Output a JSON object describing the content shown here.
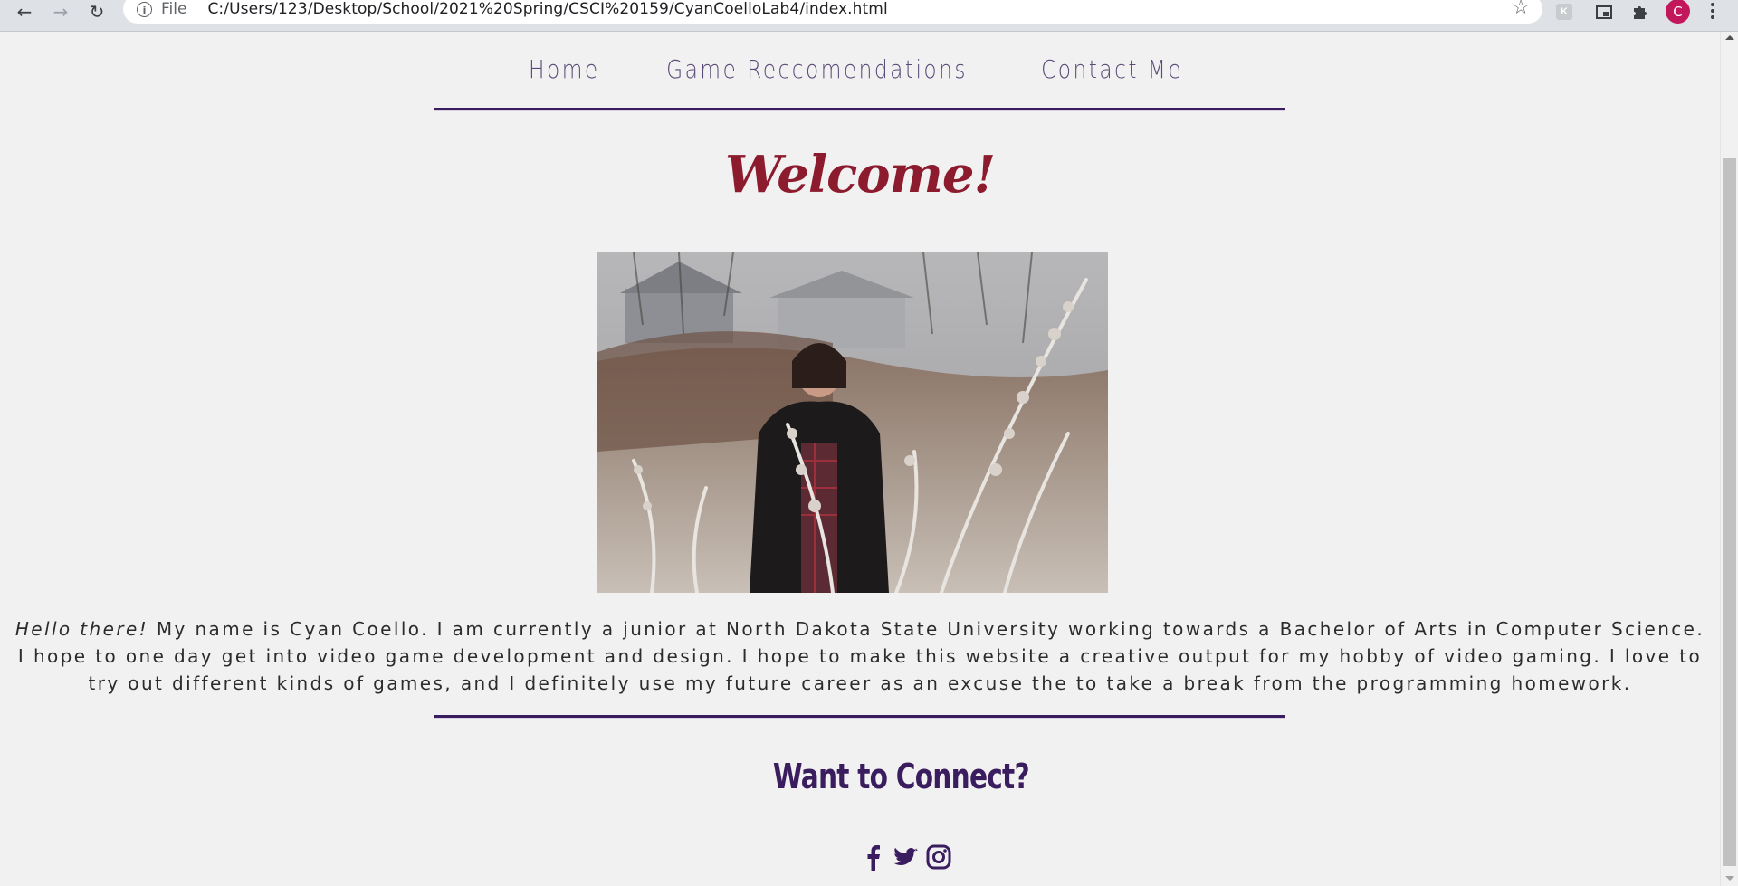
{
  "browser": {
    "scheme": "File",
    "url": "C:/Users/123/Desktop/School/2021%20Spring/CSCI%20159/CyanCoelloLab4/index.html",
    "avatar_initial": "C"
  },
  "nav": {
    "items": [
      "Home",
      "Game Reccomendations",
      "Contact Me"
    ]
  },
  "main": {
    "heading": "Welcome!",
    "bio_lead": "Hello there!",
    "bio_text": " My name is Cyan Coello. I am currently a junior at North Dakota State University working towards a Bachelor of Arts in Computer Science. I hope to one day get into video game development and design. I hope to make this website a creative output for my hobby of video gaming. I love to try out different kinds of games, and I definitely use my future career as an excuse the to take a break from the programming homework."
  },
  "footer": {
    "heading": "Want to Connect?",
    "social_icons": [
      "facebook-icon",
      "twitter-icon",
      "instagram-icon"
    ]
  },
  "colors": {
    "accent": "#3a1d5e",
    "heading": "#8c1b2e",
    "nav_text": "#5b4a78",
    "background": "#f2f1f1"
  }
}
